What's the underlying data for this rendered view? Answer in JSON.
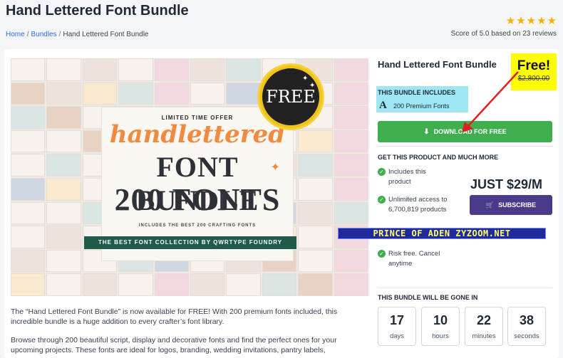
{
  "page": {
    "title": "Hand Lettered Font Bundle",
    "rating": {
      "stars": 5,
      "score_text": "Score of 5.0 based on 23 reviews"
    },
    "breadcrumb": [
      "Home",
      "Bundles",
      "Hand Lettered Font Bundle"
    ]
  },
  "hero": {
    "limited_offer": "LIMITED TIME OFFER",
    "script_title": "handlettered",
    "line1": "FONT BUNDLE",
    "line2": "200 FONTS",
    "includes": "INCLUDES THE BEST 200 CRAFTING FONTS",
    "ribbon": "THE BEST FONT COLLECTION BY QWRTYPE FOUNDRY",
    "seal": "FREE"
  },
  "sidebar": {
    "title": "Hand Lettered Font Bundle",
    "free_label": "Free!",
    "old_price": "$2,800.00",
    "includes_heading": "THIS BUNDLE INCLUDES",
    "includes_item": "200 Premium Fonts",
    "download_label": "DOWNLOAD FOR FREE",
    "get_heading": "GET THIS PRODUCT AND MUCH MORE",
    "features": [
      "Includes this product",
      "Unlimited access to 6,700,819 products",
      "Risk free. Cancel anytime"
    ],
    "price": "JUST $29/M",
    "subscribe_label": "SUBSCRIBE",
    "watermark": "PRINCE OF ADEN ZYZOOM.NET",
    "gone_heading": "THIS BUNDLE WILL BE GONE IN",
    "countdown": [
      {
        "value": "17",
        "label": "days"
      },
      {
        "value": "10",
        "label": "hours"
      },
      {
        "value": "22",
        "label": "minutes"
      },
      {
        "value": "38",
        "label": "seconds"
      }
    ]
  },
  "description": [
    "The “Hand Lettered Font Bundle” is now available for FREE! With 200 premium fonts included, this incredible bundle is a huge addition to every crafter’s font library.",
    "Browse through 200 beautiful script, display and decorative fonts and find the perfect ones for your upcoming projects. These fonts are ideal for logos, branding, wedding invitations, pantry labels,"
  ],
  "colors": {
    "accent_green": "#3fae4f",
    "subscribe_purple": "#4b3a8a",
    "highlight_yellow": "#ffff00",
    "highlight_cyan": "#9fe6f5",
    "arrow_red": "#e02020",
    "star_gold": "#f5b301"
  },
  "icons": [
    "star-icon",
    "download-icon",
    "cart-icon",
    "check-icon",
    "font-icon",
    "arrow-annotation"
  ]
}
